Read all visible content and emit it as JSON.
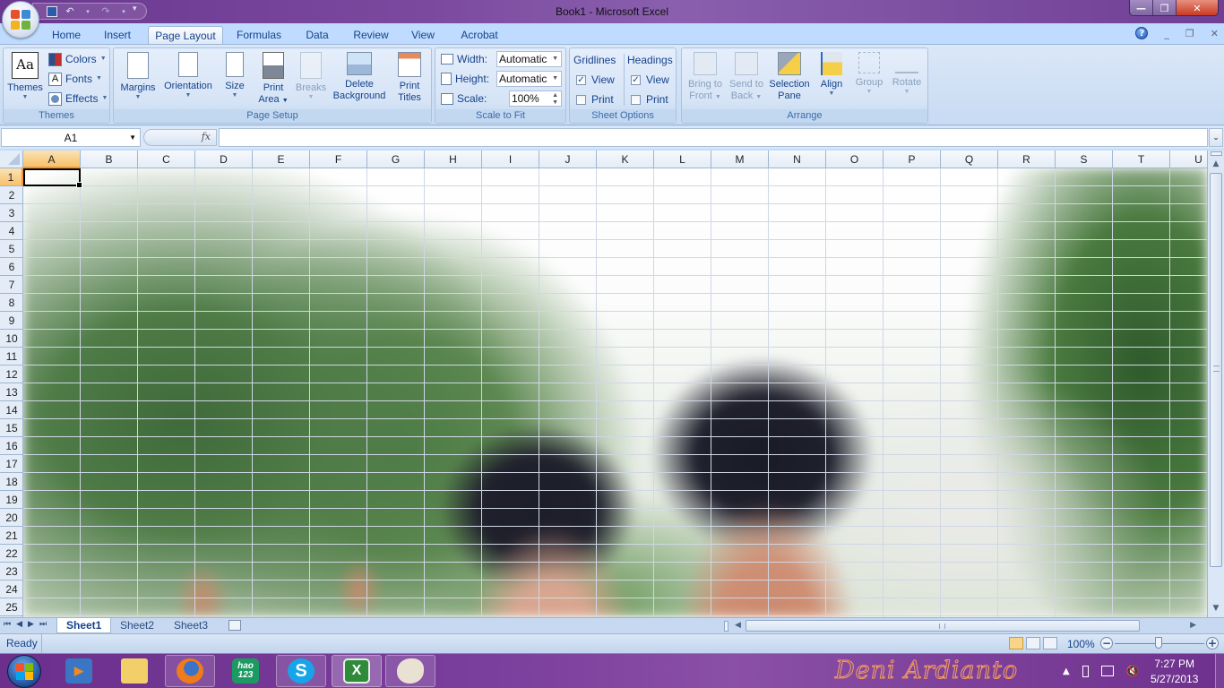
{
  "window": {
    "title": "Book1 - Microsoft Excel",
    "controls": {
      "minimize": "—",
      "maximize": "❐",
      "close": "✕"
    }
  },
  "quick_access": {
    "save_icon": "save-icon",
    "undo_icon": "↶",
    "redo_icon": "↷",
    "customize_icon": "▾"
  },
  "ribbon_tabs": [
    {
      "label": "Home",
      "active": false
    },
    {
      "label": "Insert",
      "active": false
    },
    {
      "label": "Page Layout",
      "active": true
    },
    {
      "label": "Formulas",
      "active": false
    },
    {
      "label": "Data",
      "active": false
    },
    {
      "label": "Review",
      "active": false
    },
    {
      "label": "View",
      "active": false
    },
    {
      "label": "Acrobat",
      "active": false
    }
  ],
  "ribbon_right": {
    "help": "?",
    "minimize": "_",
    "restore": "❐",
    "close": "✕"
  },
  "ribbon": {
    "themes": {
      "label": "Themes",
      "themes_button": "Themes",
      "colors": "Colors",
      "fonts": "Fonts",
      "effects": "Effects"
    },
    "page_setup": {
      "label": "Page Setup",
      "margins": "Margins",
      "orientation": "Orientation",
      "size": "Size",
      "print_area_1": "Print",
      "print_area_2": "Area",
      "breaks": "Breaks",
      "delete_bg_1": "Delete",
      "delete_bg_2": "Background",
      "print_titles_1": "Print",
      "print_titles_2": "Titles"
    },
    "scale_to_fit": {
      "label": "Scale to Fit",
      "width_label": "Width:",
      "width_value": "Automatic",
      "height_label": "Height:",
      "height_value": "Automatic",
      "scale_label": "Scale:",
      "scale_value": "100%"
    },
    "sheet_options": {
      "label": "Sheet Options",
      "gridlines": "Gridlines",
      "headings": "Headings",
      "gridlines_view": {
        "label": "View",
        "checked": true
      },
      "gridlines_print": {
        "label": "Print",
        "checked": false
      },
      "headings_view": {
        "label": "View",
        "checked": true
      },
      "headings_print": {
        "label": "Print",
        "checked": false
      }
    },
    "arrange": {
      "label": "Arrange",
      "bring_front_1": "Bring to",
      "bring_front_2": "Front",
      "send_back_1": "Send to",
      "send_back_2": "Back",
      "selection_pane_1": "Selection",
      "selection_pane_2": "Pane",
      "align": "Align",
      "group": "Group",
      "rotate": "Rotate"
    }
  },
  "formula_bar": {
    "name_box": "A1",
    "fx": "fx",
    "formula": ""
  },
  "grid": {
    "columns": [
      "A",
      "B",
      "C",
      "D",
      "E",
      "F",
      "G",
      "H",
      "I",
      "J",
      "K",
      "L",
      "M",
      "N",
      "O",
      "P",
      "Q",
      "R",
      "S",
      "T",
      "U"
    ],
    "rows": [
      "1",
      "2",
      "3",
      "4",
      "5",
      "6",
      "7",
      "8",
      "9",
      "10",
      "11",
      "12",
      "13",
      "14",
      "15",
      "16",
      "17",
      "18",
      "19",
      "20",
      "21",
      "22",
      "23",
      "24",
      "25"
    ],
    "active_cell": "A1",
    "background": "sheet background photo (blurred, two people in front of trees)"
  },
  "sheets": [
    {
      "label": "Sheet1",
      "active": true
    },
    {
      "label": "Sheet2",
      "active": false
    },
    {
      "label": "Sheet3",
      "active": false
    }
  ],
  "status_bar": {
    "status": "Ready",
    "zoom": "100%",
    "zoom_level": 1.0
  },
  "taskbar": {
    "apps": [
      {
        "name": "windows-media-player",
        "glyph": "▶"
      },
      {
        "name": "windows-explorer",
        "glyph": "🗀"
      },
      {
        "name": "firefox",
        "glyph": "◉"
      },
      {
        "name": "hao123",
        "glyph": "hao\n123"
      },
      {
        "name": "skype",
        "glyph": "S"
      },
      {
        "name": "excel",
        "glyph": "X"
      },
      {
        "name": "paint",
        "glyph": "🎨"
      }
    ],
    "signature": "Deni Ardianto",
    "time": "7:27 PM",
    "date": "5/27/2013"
  },
  "colors": {
    "title_bar": "#7b4a9f",
    "ribbon": "#dbe7f7",
    "selected_header": "#f7c16a",
    "taskbar": "#7a3e9c",
    "signature": "#f47f2a"
  }
}
